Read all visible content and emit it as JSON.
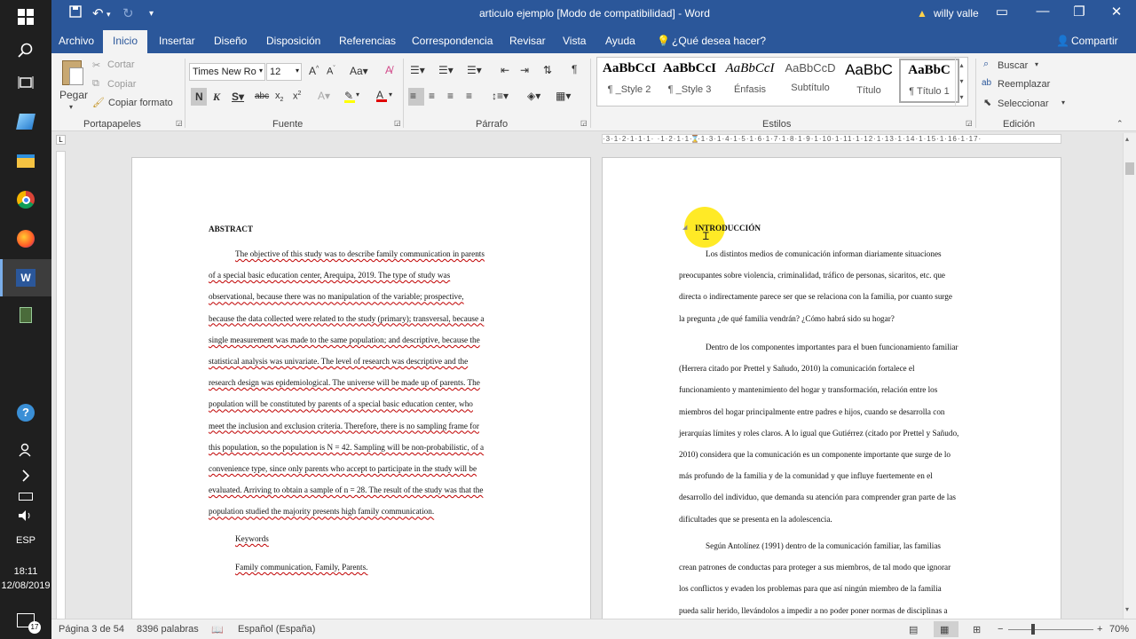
{
  "titlebar": {
    "title": "articulo ejemplo [Modo de compatibilidad]  -  Word",
    "user": "willy valle"
  },
  "tabs": [
    "Archivo",
    "Inicio",
    "Insertar",
    "Diseño",
    "Disposición",
    "Referencias",
    "Correspondencia",
    "Revisar",
    "Vista",
    "Ayuda"
  ],
  "tell_me": "¿Qué desea hacer?",
  "share": "Compartir",
  "clipboard": {
    "paste": "Pegar",
    "cut": "Cortar",
    "copy": "Copiar",
    "format": "Copiar formato",
    "group": "Portapapeles"
  },
  "font": {
    "name": "Times New Ro",
    "size": "12",
    "group": "Fuente"
  },
  "paragraph_group": "Párrafo",
  "styles": {
    "items": [
      {
        "preview": "AaBbCcI",
        "name": "¶ _Style 2"
      },
      {
        "preview": "AaBbCcI",
        "name": "¶ _Style 3"
      },
      {
        "preview": "AaBbCcI",
        "name": "Énfasis"
      },
      {
        "preview": "AaBbCcD",
        "name": "Subtítulo"
      },
      {
        "preview": "AaBbC",
        "name": "Título"
      },
      {
        "preview": "AaBbC",
        "name": "¶ Título 1"
      }
    ],
    "group": "Estilos"
  },
  "editing": {
    "find": "Buscar",
    "replace": "Reemplazar",
    "select": "Seleccionar",
    "group": "Edición"
  },
  "ruler_text": "·3·1·2·1·1·1· ·1·2·1·1·2·1·3·1·4·1·5·1·6·1·7·1·8·1·9·1·10·1·11·1·12·1·13·1·14·1·15·1·16·1·17·",
  "page_left": {
    "heading": "ABSTRACT",
    "lines": [
      "The objective of this study was to describe family communication in parents",
      "of a special basic education center, Arequipa, 2019. The type of study was",
      "observational, because there was no manipulation of the variable; prospective,",
      "because the data collected were related to the study (primary); transversal, because a",
      "single measurement was made to the same population; and descriptive, because the",
      "statistical analysis was univariate. The level of research was descriptive and the",
      "research design was epidemiological. The universe will be made up of parents. The",
      "population will be constituted by parents of a special basic education center, who",
      "meet the inclusion and exclusion criteria. Therefore, there is no sampling frame for",
      "this population, so the population is N = 42. Sampling will be non-probabilistic, of a",
      "convenience type, since only parents who accept to participate in the study will be",
      "evaluated.  Arriving to obtain a sample of n = 28. The result of the study was that the",
      "population studied the majority presents high family communication."
    ],
    "keywords_label": "Keywords",
    "keywords": "Family communication, Family, Parents."
  },
  "page_right": {
    "heading": "INTRODUCCIÓN",
    "p1": [
      "Los distintos medios de comunicación informan diariamente situaciones",
      "preocupantes sobre violencia, criminalidad, tráfico de personas, sicaritos, etc. que",
      "directa o indirectamente parece ser que se relaciona con la familia, por cuanto surge",
      "la pregunta ¿de qué familia vendrán? ¿Cómo habrá sido su hogar?"
    ],
    "p2": [
      "Dentro de los componentes importantes para el buen funcionamiento familiar",
      "(Herrera citado por Prettel y Sañudo, 2010) la comunicación fortalece el",
      "funcionamiento y mantenimiento del hogar y transformación, relación entre los",
      "miembros del hogar principalmente entre padres e hijos, cuando se desarrolla con",
      "jerarquías límites y roles claros. A lo igual que Gutiérrez (citado por Prettel y Sañudo,",
      "2010) considera que la comunicación es un componente importante que surge de lo",
      "más profundo de la familia y de la comunidad y que influye fuertemente en el",
      "desarrollo del individuo, que demanda su atención para comprender gran parte de las",
      "dificultades que se presenta en la adolescencia."
    ],
    "p3": [
      "Según Antolínez  (1991) dentro de la comunicación familiar, las familias",
      "crean patrones de conductas para proteger a sus miembros, de tal modo que ignorar",
      "los conflictos y evaden los problemas para que así ningún miembro de la familia",
      "pueda salir herido, llevándolos a impedir a no poder poner normas de disciplinas a"
    ]
  },
  "status": {
    "page": "Página 3 de 54",
    "words": "8396 palabras",
    "lang": "Español (España)",
    "zoom": "70%"
  },
  "taskbar": {
    "lang": "ESP",
    "time": "18:11",
    "date": "12/08/2019",
    "notif": "17"
  }
}
